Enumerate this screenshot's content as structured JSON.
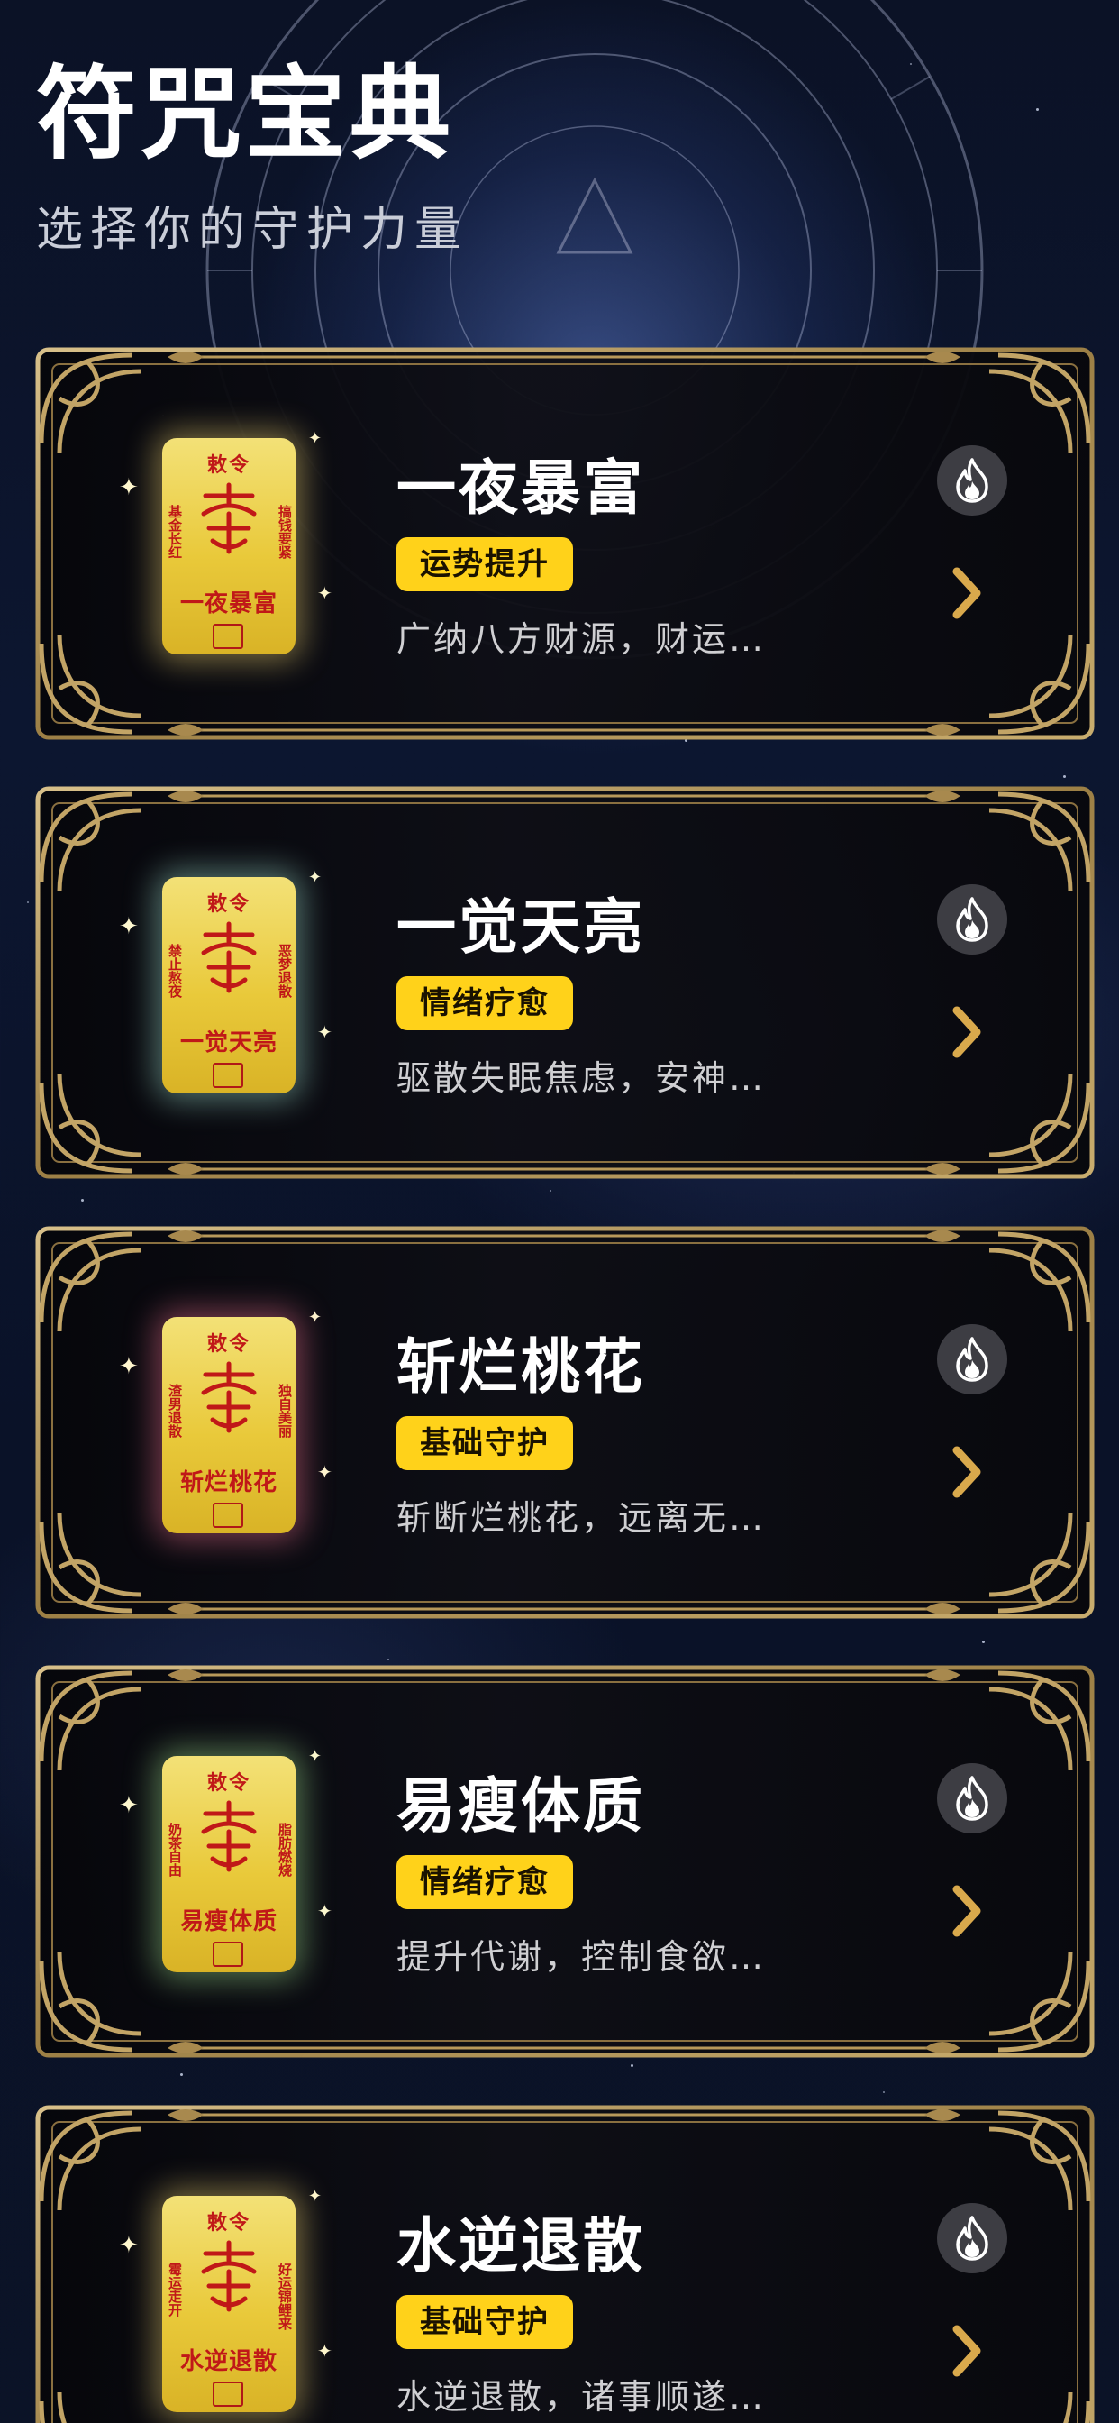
{
  "header": {
    "title": "符咒宝典",
    "subtitle": "选择你的守护力量"
  },
  "colors": {
    "tag_bg": "#ffd21a",
    "gold": "#b8995a",
    "talisman": "#e9c93a",
    "talisman_ink": "#c01818"
  },
  "cards": [
    {
      "name": "一夜暴富",
      "tag": "运势提升",
      "desc": "广纳八方财源，财运…",
      "talisman": {
        "head": "敕令",
        "foot": "一夜暴富",
        "left": "基金长红",
        "right": "搞钱要紧"
      },
      "icon": "fire-icon"
    },
    {
      "name": "一觉天亮",
      "tag": "情绪疗愈",
      "desc": "驱散失眠焦虑，安神…",
      "talisman": {
        "head": "敕令",
        "foot": "一觉天亮",
        "left": "禁止熬夜",
        "right": "恶梦退散"
      },
      "icon": "fire-icon"
    },
    {
      "name": "斩烂桃花",
      "tag": "基础守护",
      "desc": "斩断烂桃花，远离无…",
      "talisman": {
        "head": "敕令",
        "foot": "斩烂桃花",
        "left": "渣男退散",
        "right": "独自美丽"
      },
      "icon": "fire-icon"
    },
    {
      "name": "易瘦体质",
      "tag": "情绪疗愈",
      "desc": "提升代谢，控制食欲…",
      "talisman": {
        "head": "敕令",
        "foot": "易瘦体质",
        "left": "奶茶自由",
        "right": "脂肪燃烧"
      },
      "icon": "fire-icon"
    },
    {
      "name": "水逆退散",
      "tag": "基础守护",
      "desc": "水逆退散，诸事顺遂…",
      "talisman": {
        "head": "敕令",
        "foot": "水逆退散",
        "left": "霉运走开",
        "right": "好运锦鲤来"
      },
      "icon": "fire-icon"
    }
  ]
}
